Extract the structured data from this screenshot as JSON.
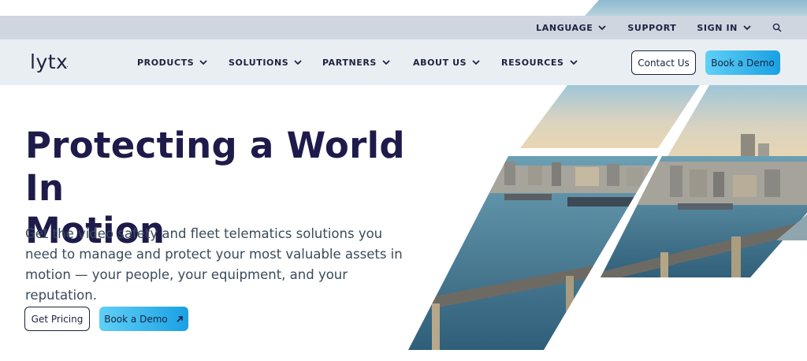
{
  "utility_bar": {
    "language": "LANGUAGE",
    "support": "SUPPORT",
    "sign_in": "SIGN IN",
    "search_icon": "search-icon"
  },
  "nav": {
    "logo": "lytx",
    "logo_mark": ".",
    "items": [
      {
        "label": "PRODUCTS"
      },
      {
        "label": "SOLUTIONS"
      },
      {
        "label": "PARTNERS"
      },
      {
        "label": "ABOUT US"
      },
      {
        "label": "RESOURCES"
      }
    ],
    "contact_label": "Contact Us",
    "demo_label": "Book a Demo"
  },
  "hero": {
    "title_line1": "Protecting a World In",
    "title_line2": "Motion",
    "subtitle": "Get the video safety and fleet telematics solutions you need to manage and protect your most valuable assets in motion — your people, your equipment, and your reputation.",
    "pricing_label": "Get Pricing",
    "demo_label": "Book a Demo",
    "demo_icon": "arrow-up-right-icon"
  },
  "colors": {
    "navy": "#1d2240",
    "accent_start": "#5fd0f7",
    "accent_end": "#1aa0e3",
    "utility_bg": "#cfd6df"
  }
}
